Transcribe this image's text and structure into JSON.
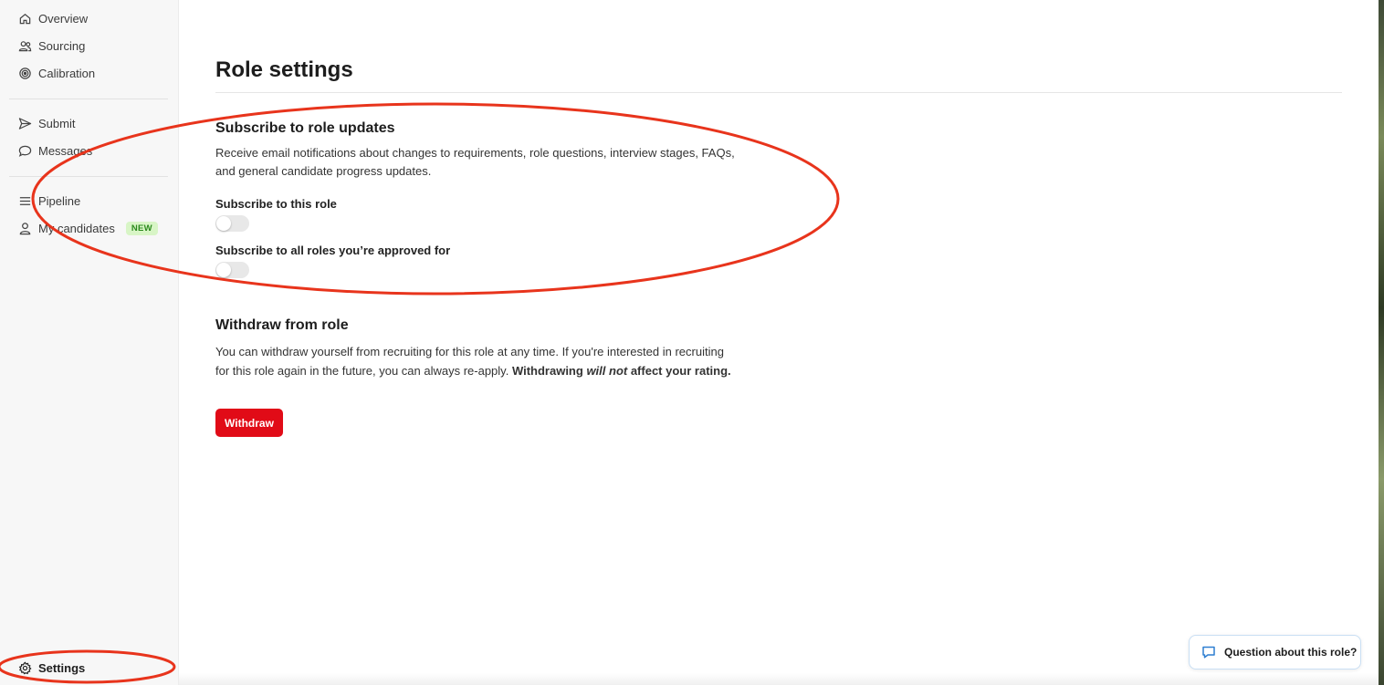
{
  "sidebar": {
    "items": [
      {
        "label": "Overview",
        "icon": "home-icon"
      },
      {
        "label": "Sourcing",
        "icon": "people-icon"
      },
      {
        "label": "Calibration",
        "icon": "target-icon"
      },
      {
        "label": "Submit",
        "icon": "send-icon"
      },
      {
        "label": "Messages",
        "icon": "chat-bubble-icon"
      },
      {
        "label": "Pipeline",
        "icon": "list-icon"
      },
      {
        "label": "My candidates",
        "icon": "user-icon",
        "badge": "NEW"
      }
    ],
    "settings": {
      "label": "Settings",
      "icon": "gear-icon"
    }
  },
  "page": {
    "title": "Role settings",
    "subscribe": {
      "heading": "Subscribe to role updates",
      "description": "Receive email notifications about changes to requirements, role questions, interview stages, FAQs, and general candidate progress updates.",
      "toggles": [
        {
          "label": "Subscribe to this role",
          "on": false
        },
        {
          "label": "Subscribe to all roles you’re approved for",
          "on": false
        }
      ]
    },
    "withdraw": {
      "heading": "Withdraw from role",
      "description_part1": "You can withdraw yourself from recruiting for this role at any time. If you're interested in recruiting for this role again in the future, you can always re-apply. ",
      "description_bold1": "Withdrawing ",
      "description_bold_italic": "will not",
      "description_bold2": " affect your rating.",
      "button_label": "Withdraw"
    }
  },
  "help": {
    "button_label": "Question about this role?",
    "icon": "comment-icon"
  },
  "colors": {
    "accent_red": "#e10b17",
    "annotation_red": "#e8341c",
    "badge_bg": "#d8f5c6",
    "badge_text": "#2c8a1e"
  }
}
